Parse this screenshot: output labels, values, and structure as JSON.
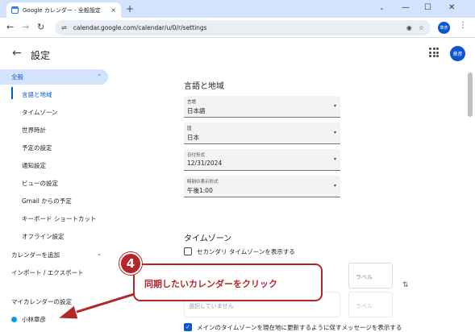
{
  "browser": {
    "tab_title": "Google カレンダー - 全般設定",
    "tab_close": "×",
    "new_tab": "+",
    "tab_dropdown": "⌄",
    "min": "—",
    "max": "☐",
    "close": "✕",
    "back": "←",
    "forward": "→",
    "reload": "↻",
    "site_info": "⇌",
    "url": "calendar.google.com/calendar/u/0/r/settings",
    "eye_icon": "◉",
    "star_icon": "☆",
    "profile_initials": "章彦",
    "menu": "⋮"
  },
  "header": {
    "back": "←",
    "title": "設定",
    "avatar": "章彦"
  },
  "sidebar": {
    "general": "全般",
    "general_chevron": "⌃",
    "sub_items": [
      "言語と地域",
      "タイムゾーン",
      "世界時計",
      "予定の設定",
      "通知設定",
      "ビューの設定",
      "Gmail からの予定",
      "キーボード ショートカット",
      "オフライン設定"
    ],
    "add_calendar": "カレンダーを追加",
    "import_export": "インポート / エクスポート",
    "my_calendars": "マイカレンダーの設定",
    "calendar_user": "小林章彦",
    "chevron": "⌄"
  },
  "main": {
    "language_region_title": "言語と地域",
    "fields": [
      {
        "label": "言語",
        "value": "日本語"
      },
      {
        "label": "国",
        "value": "日本"
      },
      {
        "label": "日付形式",
        "value": "12/31/2024"
      },
      {
        "label": "時刻の表示形式",
        "value": "午後1:00"
      }
    ],
    "dropdown_arrow": "▾",
    "timezone_title": "タイムゾーン",
    "secondary_tz_checkbox": "セカンダリ タイムゾーンを表示する",
    "tz_label_1": "ラベル",
    "tz_label_2": "ラベル",
    "tz_not_selected": "選択していません",
    "swap": "⇅",
    "update_tz_checkbox": "メインのタイムゾーンを現在地に更新するように促すメッセージを表示する",
    "check": "✓"
  },
  "annotation": {
    "step": "4",
    "text": "同期したいカレンダーをクリック"
  },
  "colors": {
    "accent": "#0b57d0",
    "callout": "#b3262a",
    "calendar_dot": "#039be5"
  }
}
